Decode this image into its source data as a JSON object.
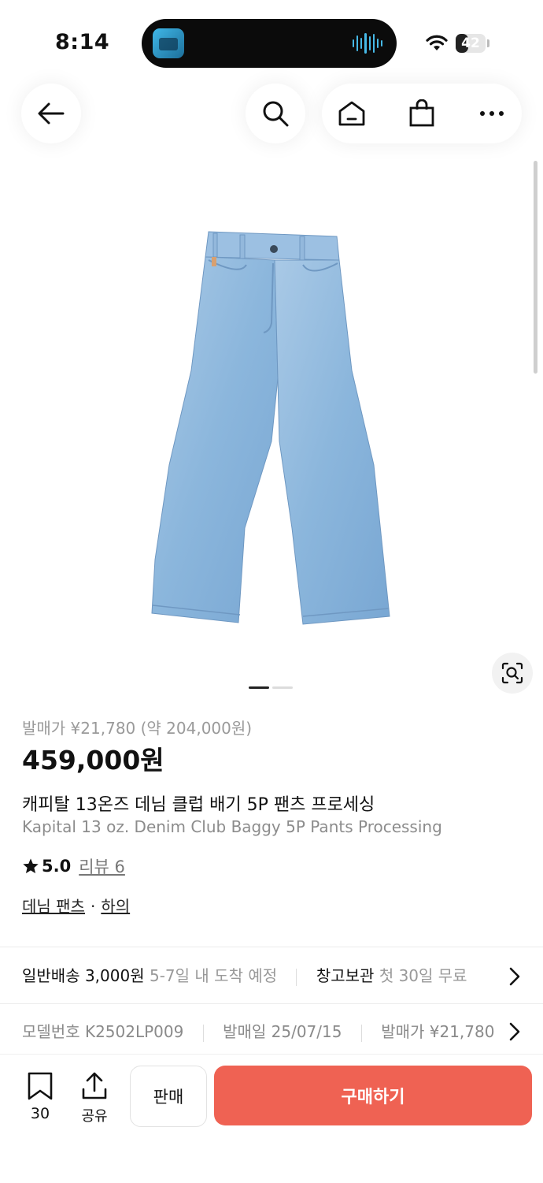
{
  "status_bar": {
    "time": "8:14",
    "battery": "42",
    "battery_level_percent": 42
  },
  "nav": {
    "back_icon": "back-arrow-icon",
    "search_icon": "search-icon",
    "home_icon": "home-icon",
    "bag_icon": "shopping-bag-icon",
    "more_icon": "more-dots-icon"
  },
  "gallery": {
    "image": "light-blue-baggy-jeans",
    "page_count": 2,
    "current_page": 1,
    "lens_icon": "image-search-icon"
  },
  "product": {
    "retail_price": "발매가 ¥21,780 (약 204,000원)",
    "price": "459,000원",
    "name_ko": "캐피탈 13온즈 데님 클럽 배기 5P 팬츠 프로세싱",
    "name_en": "Kapital 13 oz. Denim Club Baggy 5P Pants Processing",
    "rating": "5.0",
    "reviews": "리뷰 6",
    "category_1": "데님 팬츠",
    "category_sep": "·",
    "category_2": "하의"
  },
  "shipping": {
    "delivery_label": "일반배송 3,000원",
    "delivery_eta": "5-7일 내 도착 예정",
    "storage_label": "창고보관",
    "storage_note": "첫 30일 무료"
  },
  "meta": {
    "model": "모델번호 K2502LP009",
    "release_date": "발매일 25/07/15",
    "retail_short": "발매가 ¥21,780"
  },
  "bottom_bar": {
    "bookmark_count": "30",
    "share_label": "공유",
    "sell_label": "판매",
    "buy_label": "구매하기"
  },
  "colors": {
    "buy_button": "#ef6253",
    "denim": "#8db8dc"
  }
}
